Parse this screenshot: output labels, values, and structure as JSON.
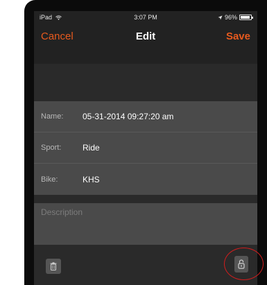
{
  "status_bar": {
    "device": "iPad",
    "time": "3:07 PM",
    "battery": "96%",
    "battery_level": 0.96
  },
  "nav": {
    "cancel_label": "Cancel",
    "title": "Edit",
    "save_label": "Save"
  },
  "form": {
    "fields": [
      {
        "label": "Name:",
        "value": "05-31-2014 09:27:20 am"
      },
      {
        "label": "Sport:",
        "value": "Ride"
      },
      {
        "label": "Bike:",
        "value": "KHS"
      }
    ],
    "description_placeholder": "Description"
  },
  "toolbar": {
    "trash_icon": "trash-icon",
    "lock_icon": "lock-icon"
  },
  "colors": {
    "accent": "#e85a1e",
    "annotation": "#d21d1d",
    "background": "#2a2a2a",
    "field_background": "#4a4a4a"
  }
}
